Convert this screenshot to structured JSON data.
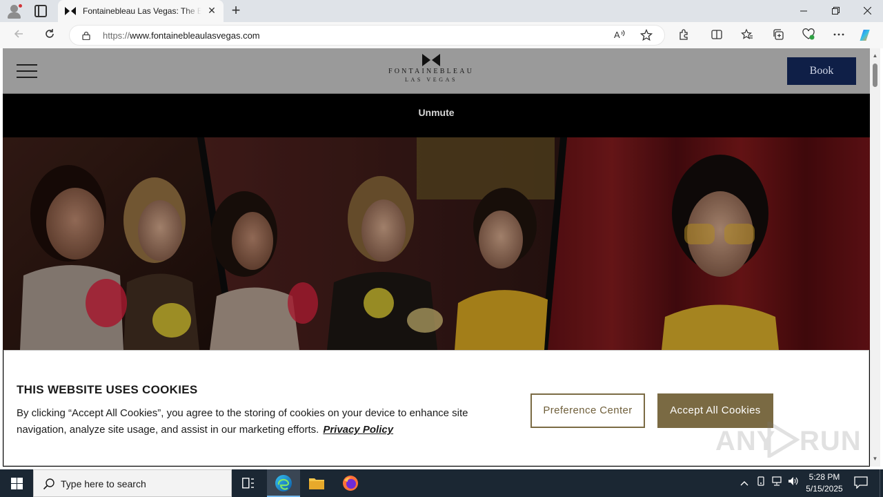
{
  "browser": {
    "tab_title": "Fontainebleau Las Vegas: The Best Luxury Resort",
    "url_protocol": "https://",
    "url_host": "www.fontainebleaulasvegas.com",
    "minimize_glyph": "—",
    "restore_glyph": "❐",
    "close_glyph": "✕",
    "new_tab_glyph": "+",
    "tab_close_glyph": "✕"
  },
  "site": {
    "logo_word": "FONTAINEBLEAU",
    "logo_sub": "LAS VEGAS",
    "book_label": "Book",
    "unmute_label": "Unmute",
    "brand_color": "#0f1f47"
  },
  "cookie_banner": {
    "heading": "THIS WEBSITE USES COOKIES",
    "message": "By clicking “Accept All Cookies”, you agree to the storing of cookies on your device to enhance site navigation, analyze site usage, and assist in our marketing efforts.",
    "privacy_link": "Privacy Policy",
    "preference_label": "Preference Center",
    "accept_label": "Accept All Cookies",
    "accent_color": "#7a6a43"
  },
  "watermark": {
    "text_left": "ANY",
    "text_right": "RUN"
  },
  "taskbar": {
    "search_placeholder": "Type here to search",
    "time": "5:28 PM",
    "date": "5/15/2025"
  }
}
